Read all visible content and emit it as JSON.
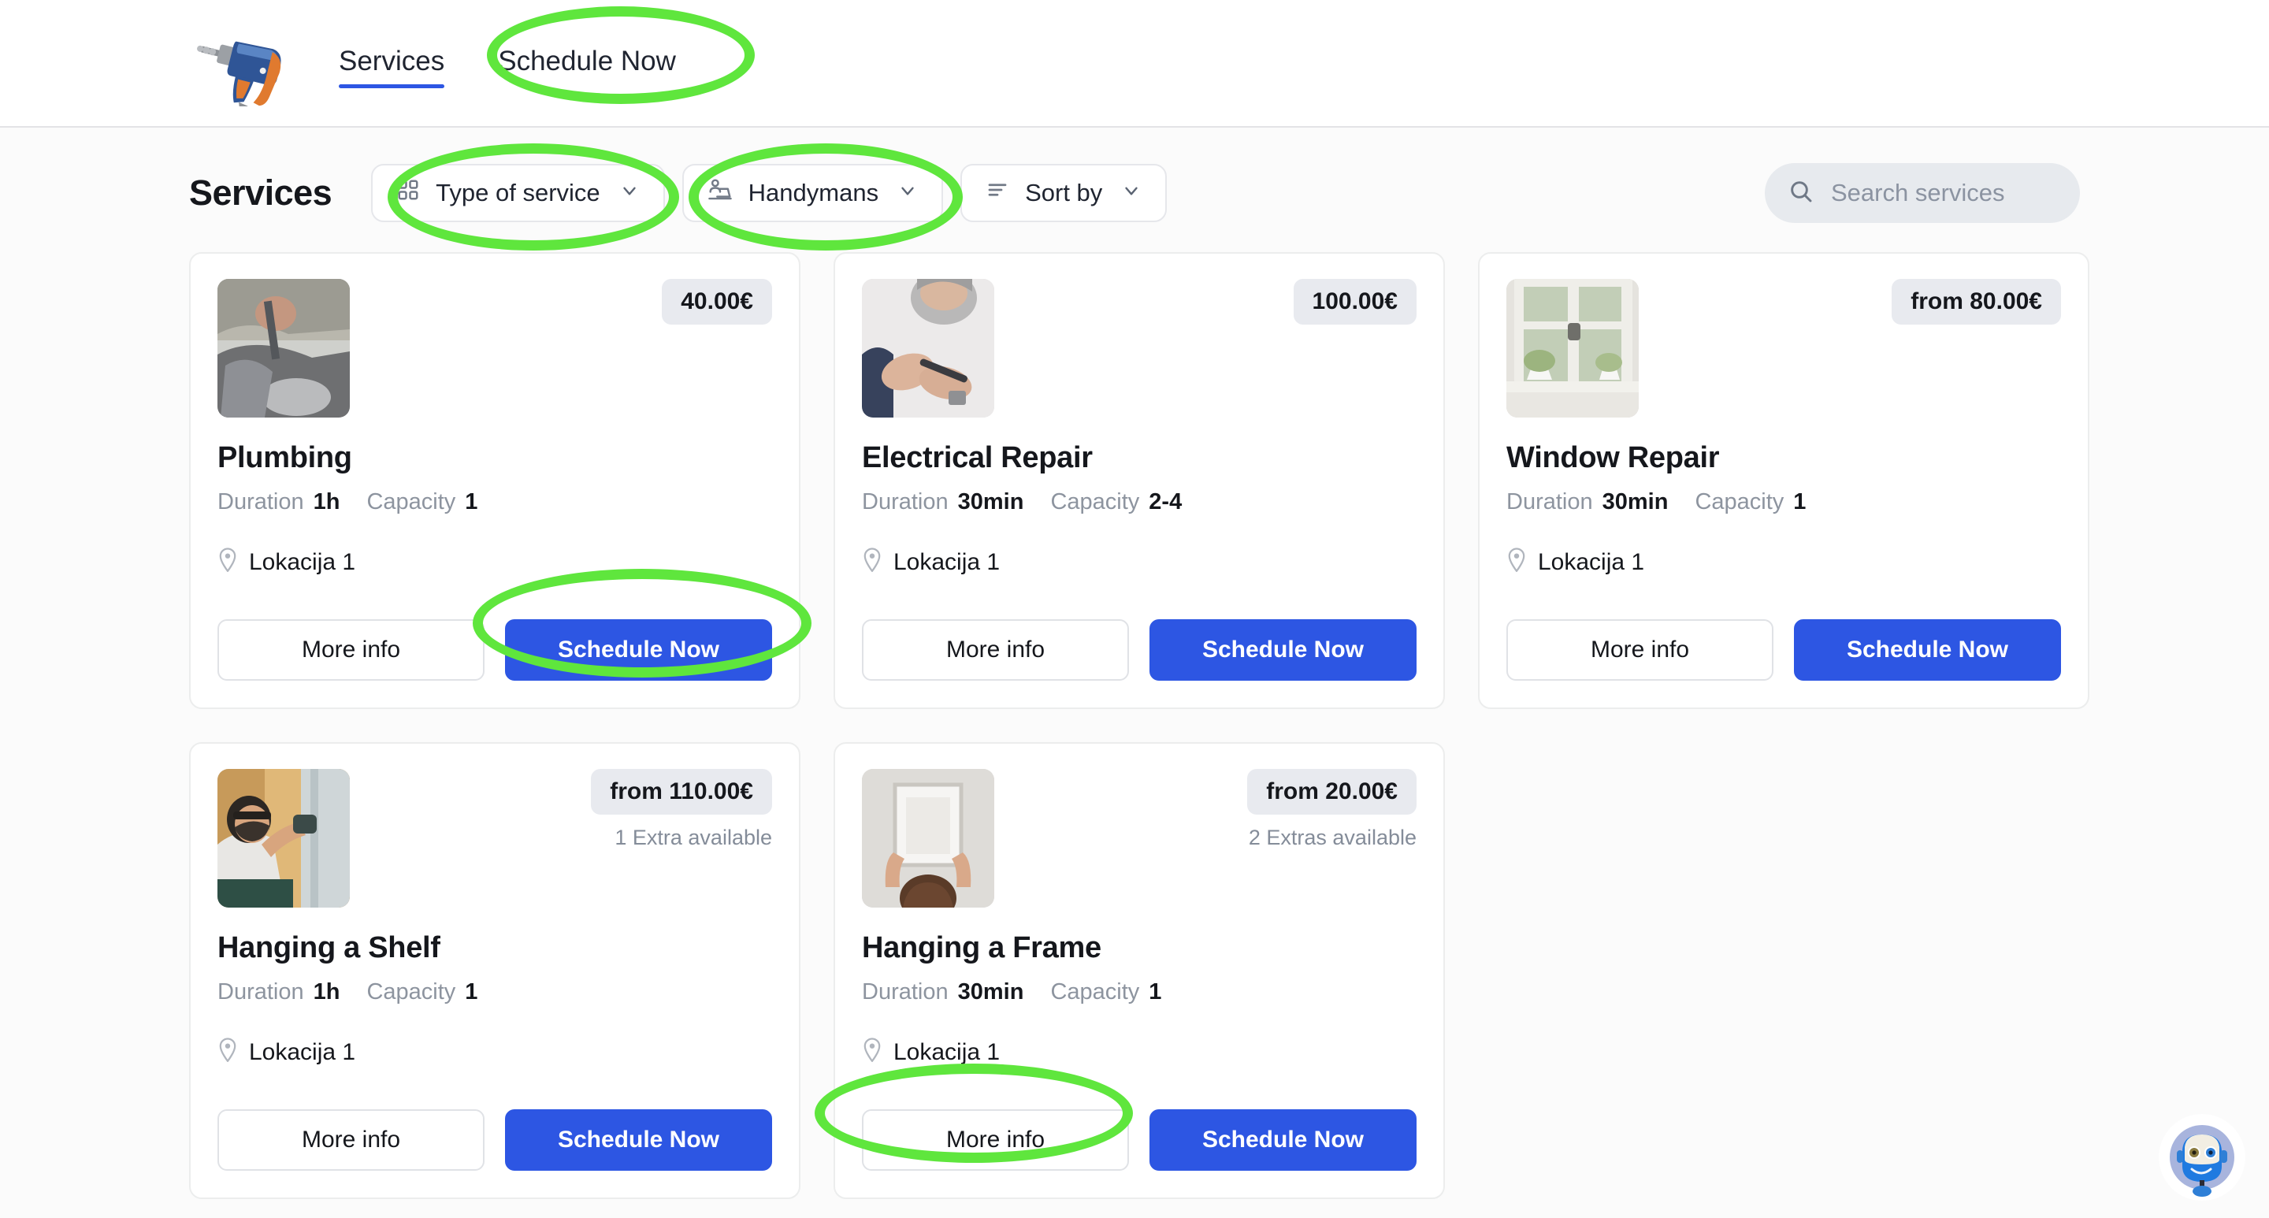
{
  "header": {
    "logo_icon": "power-drill-icon",
    "tabs": [
      {
        "label": "Services",
        "active": true
      },
      {
        "label": "Schedule Now",
        "active": false
      }
    ]
  },
  "toolbar": {
    "title": "Services",
    "filters": [
      {
        "label": "Type of service",
        "icon": "grid-icon"
      },
      {
        "label": "Handymans",
        "icon": "person-desk-icon"
      },
      {
        "label": "Sort by",
        "icon": "sort-lines-icon"
      }
    ],
    "search": {
      "placeholder": "Search services",
      "value": "",
      "icon": "search-icon"
    }
  },
  "labels": {
    "duration": "Duration",
    "capacity": "Capacity",
    "more_info": "More info",
    "schedule_now": "Schedule Now",
    "location_icon": "map-pin-icon"
  },
  "services": [
    {
      "name": "Plumbing",
      "price": "40.00€",
      "extras": "",
      "duration": "1h",
      "capacity": "1",
      "location": "Lokacija 1",
      "thumb": "plumbing-photo"
    },
    {
      "name": "Electrical Repair",
      "price": "100.00€",
      "extras": "",
      "duration": "30min",
      "capacity": "2-4",
      "location": "Lokacija 1",
      "thumb": "electrical-photo"
    },
    {
      "name": "Window Repair",
      "price": "from 80.00€",
      "extras": "",
      "duration": "30min",
      "capacity": "1",
      "location": "Lokacija 1",
      "thumb": "window-photo"
    },
    {
      "name": "Hanging a Shelf",
      "price": "from 110.00€",
      "extras": "1 Extra available",
      "duration": "1h",
      "capacity": "1",
      "location": "Lokacija 1",
      "thumb": "shelf-photo"
    },
    {
      "name": "Hanging a Frame",
      "price": "from 20.00€",
      "extras": "2 Extras available",
      "duration": "30min",
      "capacity": "1",
      "location": "Lokacija 1",
      "thumb": "frame-photo"
    }
  ],
  "annotations": {
    "highlight_color": "#5fe63d",
    "targets": [
      "header-schedule-now-tab",
      "type-of-service-filter",
      "handymans-filter",
      "plumbing-schedule-now-button",
      "hanging-a-frame-more-info-button"
    ]
  },
  "chat_widget": {
    "icon": "robot-avatar-icon"
  },
  "theme": {
    "primary_blue": "#2d56e3",
    "page_background": "#fbfbfb",
    "card_background": "#ffffff",
    "badge_background": "#e8eaef",
    "muted_text": "#8d949f"
  }
}
